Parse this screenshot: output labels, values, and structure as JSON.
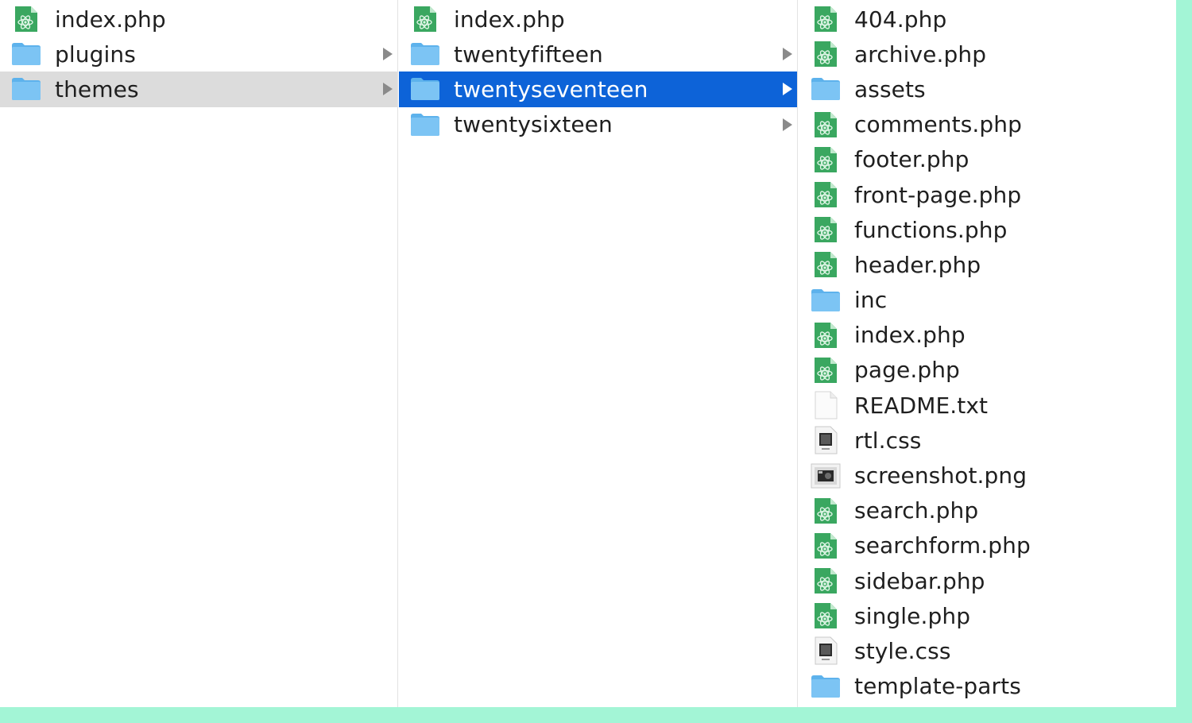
{
  "colors": {
    "selected_active": "#0d63d8",
    "selected_inactive": "#dcdcdc",
    "folder_blue": "#7cc4f4",
    "php_green": "#3aa760",
    "frame_accent": "#a3f5d6"
  },
  "columns": [
    {
      "items": [
        {
          "name": "index.php",
          "icon": "php-file-icon",
          "folder": false,
          "selected": ""
        },
        {
          "name": "plugins",
          "icon": "folder-icon",
          "folder": true,
          "selected": ""
        },
        {
          "name": "themes",
          "icon": "folder-icon",
          "folder": true,
          "selected": "inactive"
        }
      ]
    },
    {
      "items": [
        {
          "name": "index.php",
          "icon": "php-file-icon",
          "folder": false,
          "selected": ""
        },
        {
          "name": "twentyfifteen",
          "icon": "folder-icon",
          "folder": true,
          "selected": ""
        },
        {
          "name": "twentyseventeen",
          "icon": "folder-icon",
          "folder": true,
          "selected": "active"
        },
        {
          "name": "twentysixteen",
          "icon": "folder-icon",
          "folder": true,
          "selected": ""
        }
      ]
    },
    {
      "items": [
        {
          "name": "404.php",
          "icon": "php-file-icon",
          "folder": false,
          "selected": ""
        },
        {
          "name": "archive.php",
          "icon": "php-file-icon",
          "folder": false,
          "selected": ""
        },
        {
          "name": "assets",
          "icon": "folder-icon",
          "folder": true,
          "selected": "",
          "noarrow": true
        },
        {
          "name": "comments.php",
          "icon": "php-file-icon",
          "folder": false,
          "selected": ""
        },
        {
          "name": "footer.php",
          "icon": "php-file-icon",
          "folder": false,
          "selected": ""
        },
        {
          "name": "front-page.php",
          "icon": "php-file-icon",
          "folder": false,
          "selected": ""
        },
        {
          "name": "functions.php",
          "icon": "php-file-icon",
          "folder": false,
          "selected": ""
        },
        {
          "name": "header.php",
          "icon": "php-file-icon",
          "folder": false,
          "selected": ""
        },
        {
          "name": "inc",
          "icon": "folder-icon",
          "folder": true,
          "selected": "",
          "noarrow": true
        },
        {
          "name": "index.php",
          "icon": "php-file-icon",
          "folder": false,
          "selected": ""
        },
        {
          "name": "page.php",
          "icon": "php-file-icon",
          "folder": false,
          "selected": ""
        },
        {
          "name": "README.txt",
          "icon": "text-file-icon",
          "folder": false,
          "selected": ""
        },
        {
          "name": "rtl.css",
          "icon": "css-file-icon",
          "folder": false,
          "selected": ""
        },
        {
          "name": "screenshot.png",
          "icon": "image-file-icon",
          "folder": false,
          "selected": ""
        },
        {
          "name": "search.php",
          "icon": "php-file-icon",
          "folder": false,
          "selected": ""
        },
        {
          "name": "searchform.php",
          "icon": "php-file-icon",
          "folder": false,
          "selected": ""
        },
        {
          "name": "sidebar.php",
          "icon": "php-file-icon",
          "folder": false,
          "selected": ""
        },
        {
          "name": "single.php",
          "icon": "php-file-icon",
          "folder": false,
          "selected": ""
        },
        {
          "name": "style.css",
          "icon": "css-file-icon",
          "folder": false,
          "selected": ""
        },
        {
          "name": "template-parts",
          "icon": "folder-icon",
          "folder": true,
          "selected": "",
          "noarrow": true
        }
      ]
    }
  ]
}
